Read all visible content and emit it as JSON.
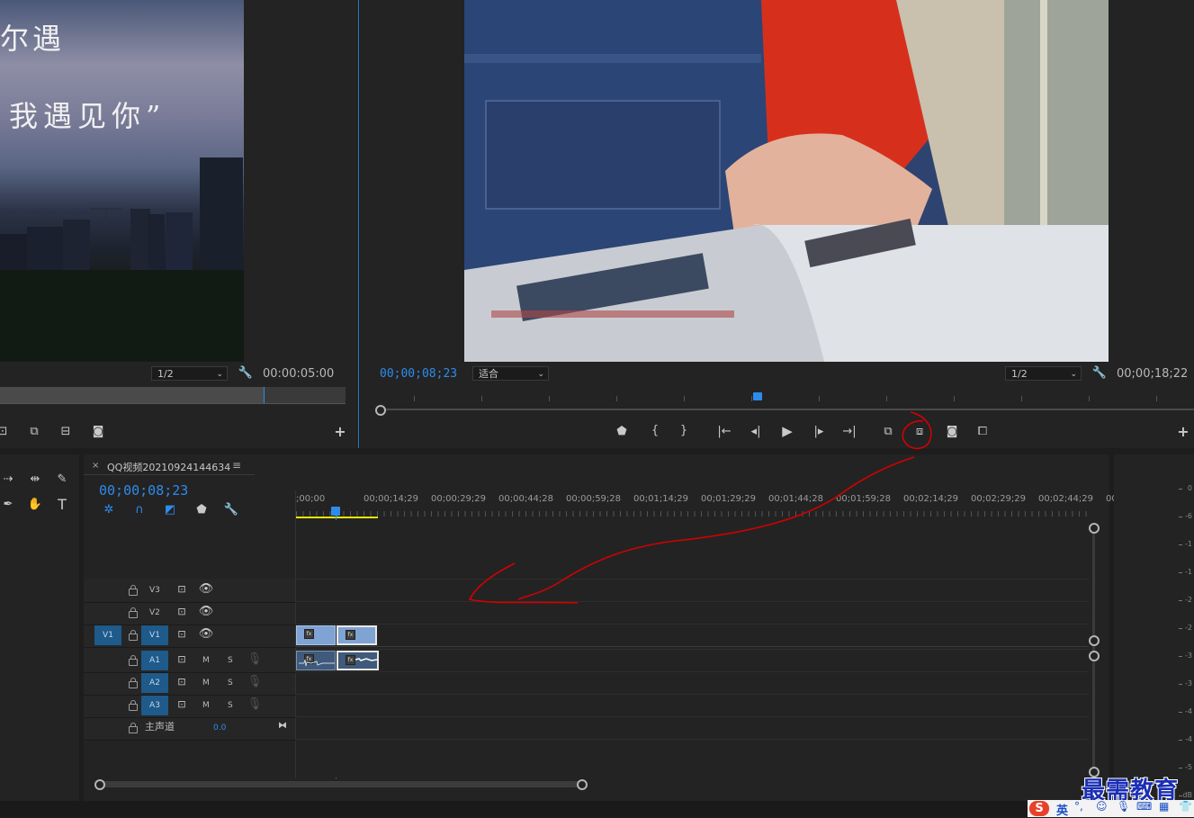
{
  "source_monitor": {
    "overlay_text_1": "尔遇",
    "overlay_text_2": "我遇见你”",
    "zoom": "1/2",
    "timecode": "00:00:05:00"
  },
  "program_monitor": {
    "current_timecode": "00;00;08;23",
    "fit_dropdown": "适合",
    "zoom": "1/2",
    "duration": "00;00;18;22"
  },
  "timeline": {
    "sequence_name": "QQ视频20210924144634",
    "playhead_timecode": "00;00;08;23",
    "ruler_labels": [
      ";00;00",
      "00;00;14;29",
      "00;00;29;29",
      "00;00;44;28",
      "00;00;59;28",
      "00;01;14;29",
      "00;01;29;29",
      "00;01;44;28",
      "00;01;59;28",
      "00;02;14;29",
      "00;02;29;29",
      "00;02;44;29",
      "00"
    ],
    "video_tracks": [
      "V3",
      "V2",
      "V1"
    ],
    "source_patch_video": "V1",
    "audio_tracks": [
      "A1",
      "A2",
      "A3"
    ],
    "mute_label": "M",
    "solo_label": "S",
    "master_label": "主声道",
    "master_value": "0.0",
    "clip_fx_label": "fx"
  },
  "audio_meter": {
    "scale": [
      "0",
      "-6",
      "-1",
      "-1",
      "-2",
      "-2",
      "-3",
      "-3",
      "-4",
      "-4",
      "-5",
      "dB"
    ]
  },
  "watermark": "最需教育",
  "ime_lang": "英",
  "colors": {
    "accent_blue": "#2d8ceb",
    "track_blue": "#1e5a8a",
    "clip_blue": "#7fa3d3",
    "annotation_red": "#d40000",
    "work_area_yellow": "#e6e600"
  }
}
